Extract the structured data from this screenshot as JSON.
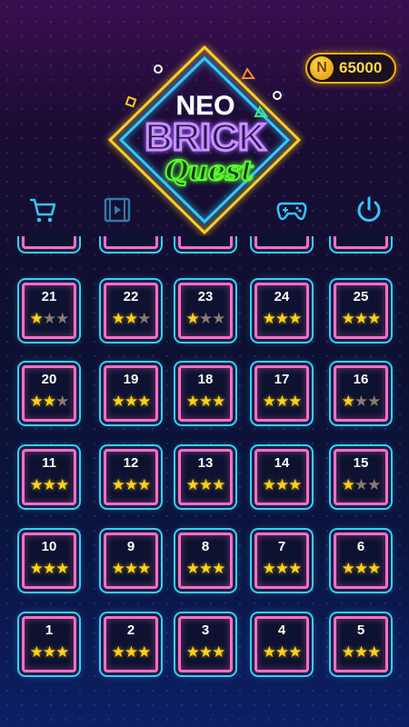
{
  "coins": {
    "amount": "65000",
    "icon_letter": "N"
  },
  "logo": {
    "line1": "NEO",
    "line2": "BRICK",
    "line3": "Quest"
  },
  "icons": [
    "cart-icon",
    "video-icon",
    "gamepad-icon",
    "power-icon"
  ],
  "levels": [
    {
      "num": "21",
      "stars": 1
    },
    {
      "num": "22",
      "stars": 2
    },
    {
      "num": "23",
      "stars": 1
    },
    {
      "num": "24",
      "stars": 3
    },
    {
      "num": "25",
      "stars": 3
    },
    {
      "num": "20",
      "stars": 2
    },
    {
      "num": "19",
      "stars": 3
    },
    {
      "num": "18",
      "stars": 3
    },
    {
      "num": "17",
      "stars": 3
    },
    {
      "num": "16",
      "stars": 1
    },
    {
      "num": "11",
      "stars": 3
    },
    {
      "num": "12",
      "stars": 3
    },
    {
      "num": "13",
      "stars": 3
    },
    {
      "num": "14",
      "stars": 3
    },
    {
      "num": "15",
      "stars": 1
    },
    {
      "num": "10",
      "stars": 3
    },
    {
      "num": "9",
      "stars": 3
    },
    {
      "num": "8",
      "stars": 3
    },
    {
      "num": "7",
      "stars": 3
    },
    {
      "num": "6",
      "stars": 3
    },
    {
      "num": "1",
      "stars": 3
    },
    {
      "num": "2",
      "stars": 3
    },
    {
      "num": "3",
      "stars": 3
    },
    {
      "num": "4",
      "stars": 3
    },
    {
      "num": "5",
      "stars": 3
    }
  ],
  "colors": {
    "tile_border": "#ff6ec7",
    "tile_glow": "#35d0ff",
    "star_on": "#ffd21a",
    "star_off": "#8a7a6e",
    "coin": "#f0b400"
  }
}
